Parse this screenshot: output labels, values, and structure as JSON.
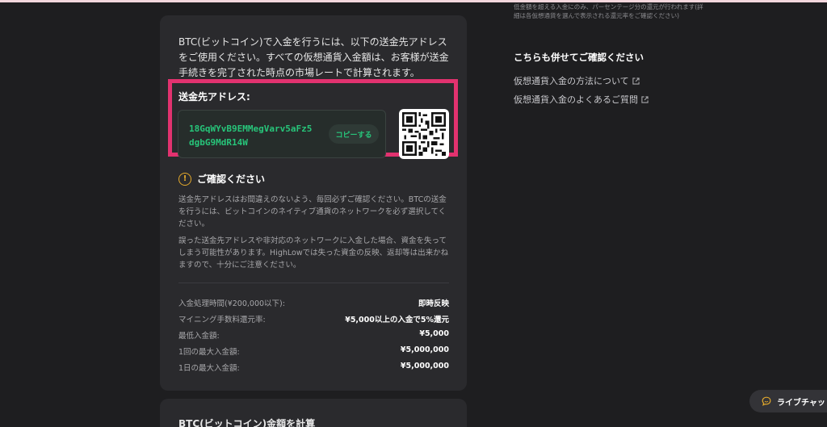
{
  "main": {
    "intro": "BTC(ビットコイン)で入金を行うには、以下の送金先アドレスをご使用ください。すべての仮想通貨入金額は、お客様が送金手続きを完了された時点の市場レートで計算されます。",
    "address_label": "送金先アドレス:",
    "address_line1": "18GqWYvB9EMMegVarv5aFz5",
    "address_line2": "dgbG9MdR14W",
    "copy_label": "コピーする",
    "warning_title": "ご確認ください",
    "warning_para1": "送金先アドレスはお間違えのないよう、毎回必ずご確認ください。BTCの送金を行うには、ビットコインのネイティブ通貨のネットワークを必ず選択してください。",
    "warning_para2": "誤った送金先アドレスや非対応のネットワークに入金した場合、資金を失ってしまう可能性があります。HighLowでは失った資金の反映、返却等は出来かねますので、十分にご注意ください。",
    "info": [
      {
        "label": "入金処理時間(¥200,000以下):",
        "value": "即時反映"
      },
      {
        "label": "マイニング手数料還元率:",
        "value": "¥5,000以上の入金で5%還元"
      },
      {
        "label": "最低入金額:",
        "value": "¥5,000"
      },
      {
        "label": "1回の最大入金額:",
        "value": "¥5,000,000"
      },
      {
        "label": "1日の最大入金額:",
        "value": "¥5,000,000"
      }
    ]
  },
  "next_card": {
    "title": "BTC(ビットコイン)金額を計算"
  },
  "side": {
    "note": "低金額を超える入金にのみ、パーセンテージ分の還元が行われます(詳細は各仮想通貨を選んで表示される還元率をご確認ください)",
    "heading": "こちらも併せてご確認ください",
    "links": [
      {
        "label": "仮想通貨入金の方法について",
        "icon": "external-link-icon"
      },
      {
        "label": "仮想通貨入金のよくあるご質問",
        "icon": "external-link-icon"
      }
    ]
  },
  "chat": {
    "label": "ライブチャット",
    "icon": "chat-bubble-icon"
  },
  "colors": {
    "highlight": "#e2326f",
    "address_green": "#27c57a",
    "warning": "#e3a92c"
  }
}
